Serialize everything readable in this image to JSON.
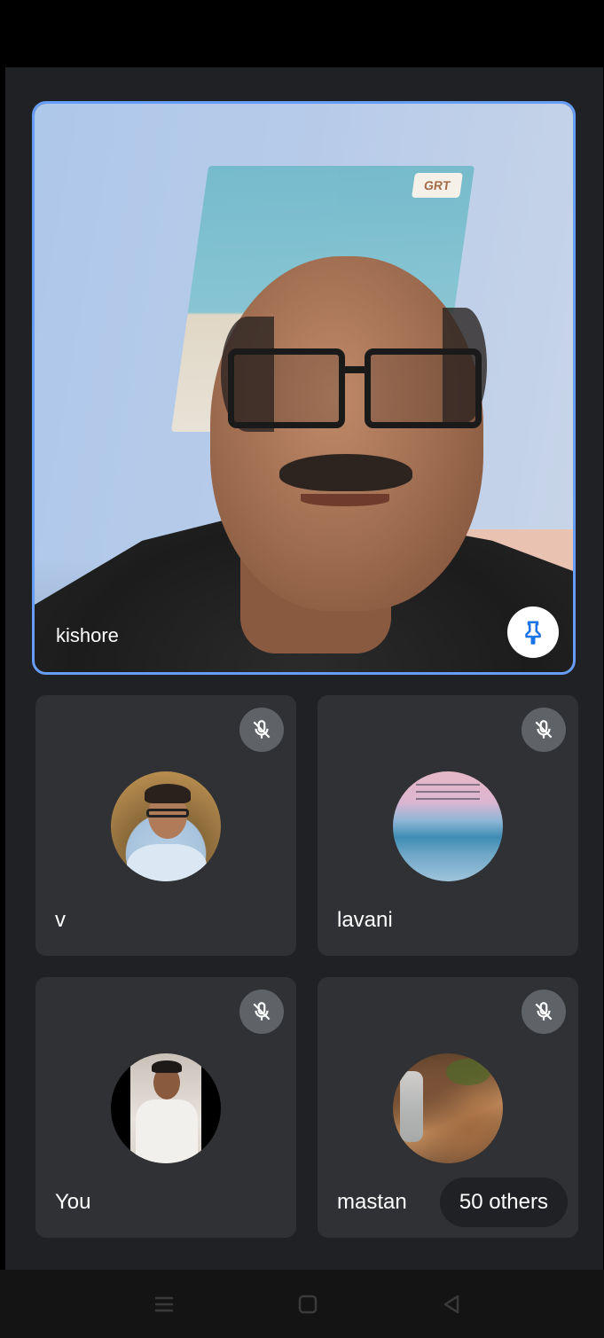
{
  "featured": {
    "name": "kishore",
    "calendar_brand": "GRT",
    "pin_icon": "pin-icon"
  },
  "participants": [
    {
      "name": "v",
      "muted": true
    },
    {
      "name": "lavani",
      "muted": true
    },
    {
      "name": "You",
      "muted": true
    },
    {
      "name": "mastan",
      "muted": true
    }
  ],
  "others_chip": "50 others",
  "colors": {
    "background": "#202124",
    "tile": "#303134",
    "accent": "#669df6",
    "mute_badge": "#5f6368"
  },
  "navbar": {
    "icons": [
      "menu-icon",
      "home-square-icon",
      "back-triangle-icon"
    ]
  }
}
